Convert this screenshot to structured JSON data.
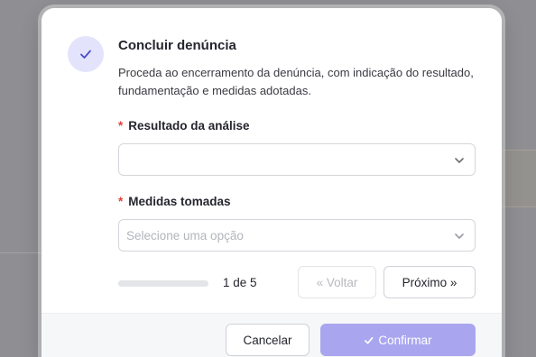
{
  "dialog": {
    "title": "Concluir denúncia",
    "description": "Proceda ao encerramento da denúncia, com indicação do resultado, fundamentação e medidas adotadas."
  },
  "fields": {
    "result": {
      "required_mark": "*",
      "label": "Resultado da análise",
      "value": ""
    },
    "measures": {
      "required_mark": "*",
      "label": "Medidas tomadas",
      "placeholder": "Selecione uma opção"
    }
  },
  "pagination": {
    "current": 1,
    "total": 5,
    "indicator": "1 de 5",
    "progress_fraction": 0.2,
    "back_label": "« Voltar",
    "next_label": "Próximo »"
  },
  "footer": {
    "cancel_label": "Cancelar",
    "confirm_label": "Confirmar"
  },
  "colors": {
    "accent": "#5b5bd6",
    "confirm_disabled": "#a9a6ef",
    "required": "#e0413b",
    "icon_bg": "#e3e4fb"
  },
  "icons": {
    "status": "check-icon",
    "dropdown": "chevron-down-icon",
    "confirm": "check-icon"
  }
}
